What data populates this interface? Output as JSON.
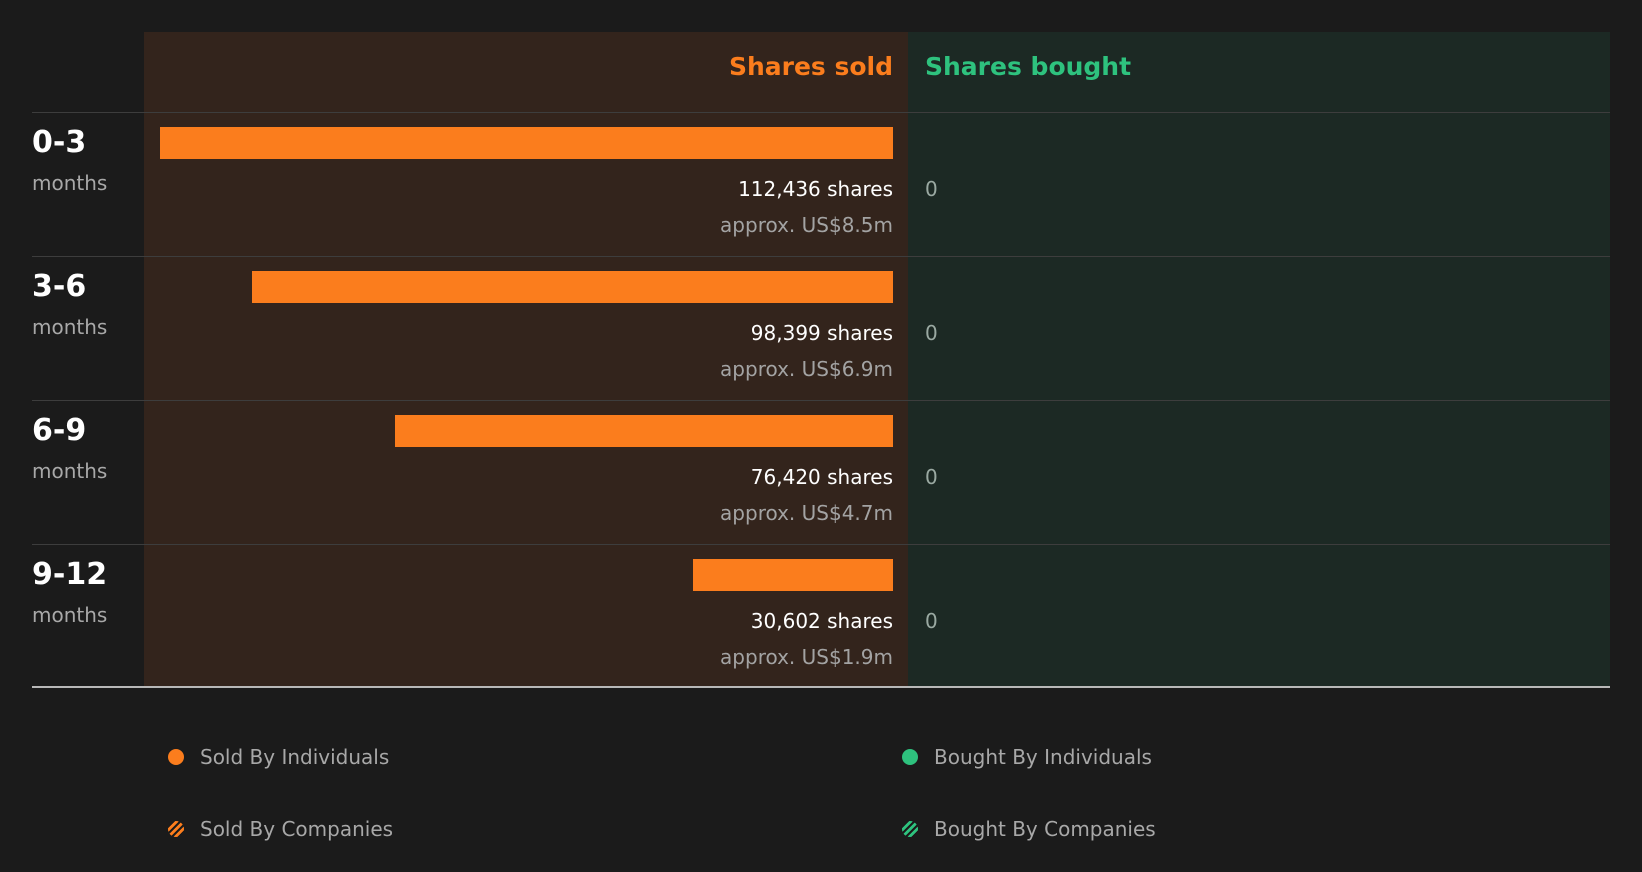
{
  "chart_data": {
    "type": "bar",
    "orientation": "horizontal",
    "header_sold": "Shares sold",
    "header_bought": "Shares bought",
    "max_value": 112436,
    "rows": [
      {
        "period": "0-3",
        "unit": "months",
        "sold": 112436,
        "sold_label": "112,436 shares",
        "approx": "approx. US$8.5m",
        "bought": 0,
        "bought_label": "0"
      },
      {
        "period": "3-6",
        "unit": "months",
        "sold": 98399,
        "sold_label": "98,399 shares",
        "approx": "approx. US$6.9m",
        "bought": 0,
        "bought_label": "0"
      },
      {
        "period": "6-9",
        "unit": "months",
        "sold": 76420,
        "sold_label": "76,420 shares",
        "approx": "approx. US$4.7m",
        "bought": 0,
        "bought_label": "0"
      },
      {
        "period": "9-12",
        "unit": "months",
        "sold": 30602,
        "sold_label": "30,602 shares",
        "approx": "approx. US$1.9m",
        "bought": 0,
        "bought_label": "0"
      }
    ],
    "legend": [
      {
        "label": "Sold By Individuals",
        "style": "solid",
        "color": "#fb7d1d"
      },
      {
        "label": "Bought By Individuals",
        "style": "solid",
        "color": "#2ec27e"
      },
      {
        "label": "Sold By Companies",
        "style": "hatched",
        "color": "#fb7d1d"
      },
      {
        "label": "Bought By Companies",
        "style": "hatched",
        "color": "#2ec27e"
      }
    ],
    "colors": {
      "sold": "#fb7d1d",
      "bought": "#2ec27e",
      "sold_panel": "#33241c",
      "bought_panel": "#1c2924"
    }
  }
}
